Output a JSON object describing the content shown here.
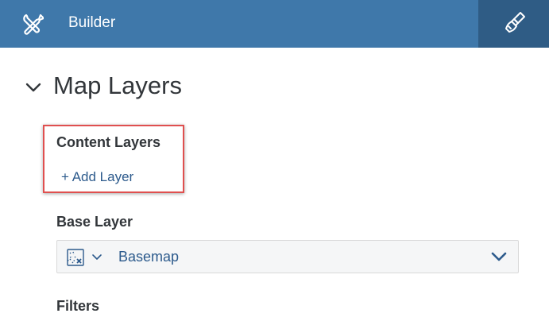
{
  "header": {
    "title": "Builder",
    "background": "#3f78aa",
    "accent_button_background": "#2f5c85",
    "left_icon": "tools-icon",
    "right_icon": "paint-brush-icon"
  },
  "section": {
    "title": "Map Layers",
    "expanded": true
  },
  "content_layers": {
    "label": "Content Layers",
    "add_link": "+ Add Layer",
    "highlight_color": "#e0504f"
  },
  "base_layer": {
    "label": "Base Layer",
    "selected_value": "Basemap",
    "icon": "basemap-icon"
  },
  "filters": {
    "label": "Filters"
  }
}
